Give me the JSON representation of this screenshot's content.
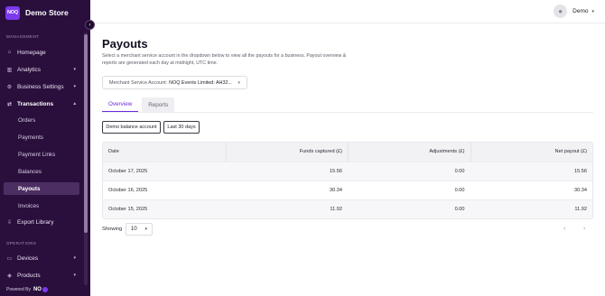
{
  "brand": {
    "logo_text": "NOQ",
    "name": "Demo Store"
  },
  "sidebar": {
    "sections": {
      "management": "MANAGEMENT",
      "operations": "OPERATIONS"
    },
    "items": {
      "homepage": "Homepage",
      "analytics": "Analytics",
      "business_settings": "Business Settings",
      "transactions": "Transactions",
      "export_library": "Export Library",
      "devices": "Devices",
      "products": "Products"
    },
    "transactions_sub": {
      "orders": "Orders",
      "payments": "Payments",
      "payment_links": "Payment Links",
      "balances": "Balances",
      "payouts": "Payouts",
      "invoices": "Invoices"
    },
    "active_item": "payouts",
    "powered_by": "Powered By",
    "powered_brand": "NO"
  },
  "header": {
    "user_name": "Demo"
  },
  "page": {
    "title": "Payouts",
    "description": "Select a merchant service account in the dropdown below to view all the payouts for a business. Payout overview & reports are generated each day at midnight, UTC time.",
    "account_select": {
      "label": "Merchant Service Account:",
      "value": "NOQ Events Limited: AH32..."
    },
    "tabs": {
      "overview": "Overview",
      "reports": "Reports"
    },
    "active_tab": "overview",
    "filters": {
      "balance_account": "Demo balance account",
      "date_range": "Last 30 days"
    }
  },
  "table": {
    "headers": {
      "date": "Date",
      "funds_captured": "Funds captured (£)",
      "adjustments": "Adjustments (£)",
      "net_payout": "Net payout (£)"
    },
    "rows": [
      {
        "date": "October 17, 2025",
        "funds_captured": "15.56",
        "adjustments": "0.00",
        "net_payout": "15.56"
      },
      {
        "date": "October 16, 2025",
        "funds_captured": "30.34",
        "adjustments": "0.00",
        "net_payout": "30.34"
      },
      {
        "date": "October 15, 2025",
        "funds_captured": "11.92",
        "adjustments": "0.00",
        "net_payout": "11.92"
      }
    ]
  },
  "pagination": {
    "showing_label": "Showing",
    "page_size": "10"
  },
  "colors": {
    "sidebar_bg": "#2a0f3d",
    "accent": "#6d28d9",
    "active_item_bg": "#4d2e63"
  },
  "icons": {
    "homepage": "home-icon",
    "analytics": "chart-icon",
    "business_settings": "gear-icon",
    "transactions": "arrows-icon",
    "export_library": "download-icon",
    "devices": "device-icon",
    "products": "tag-icon"
  }
}
